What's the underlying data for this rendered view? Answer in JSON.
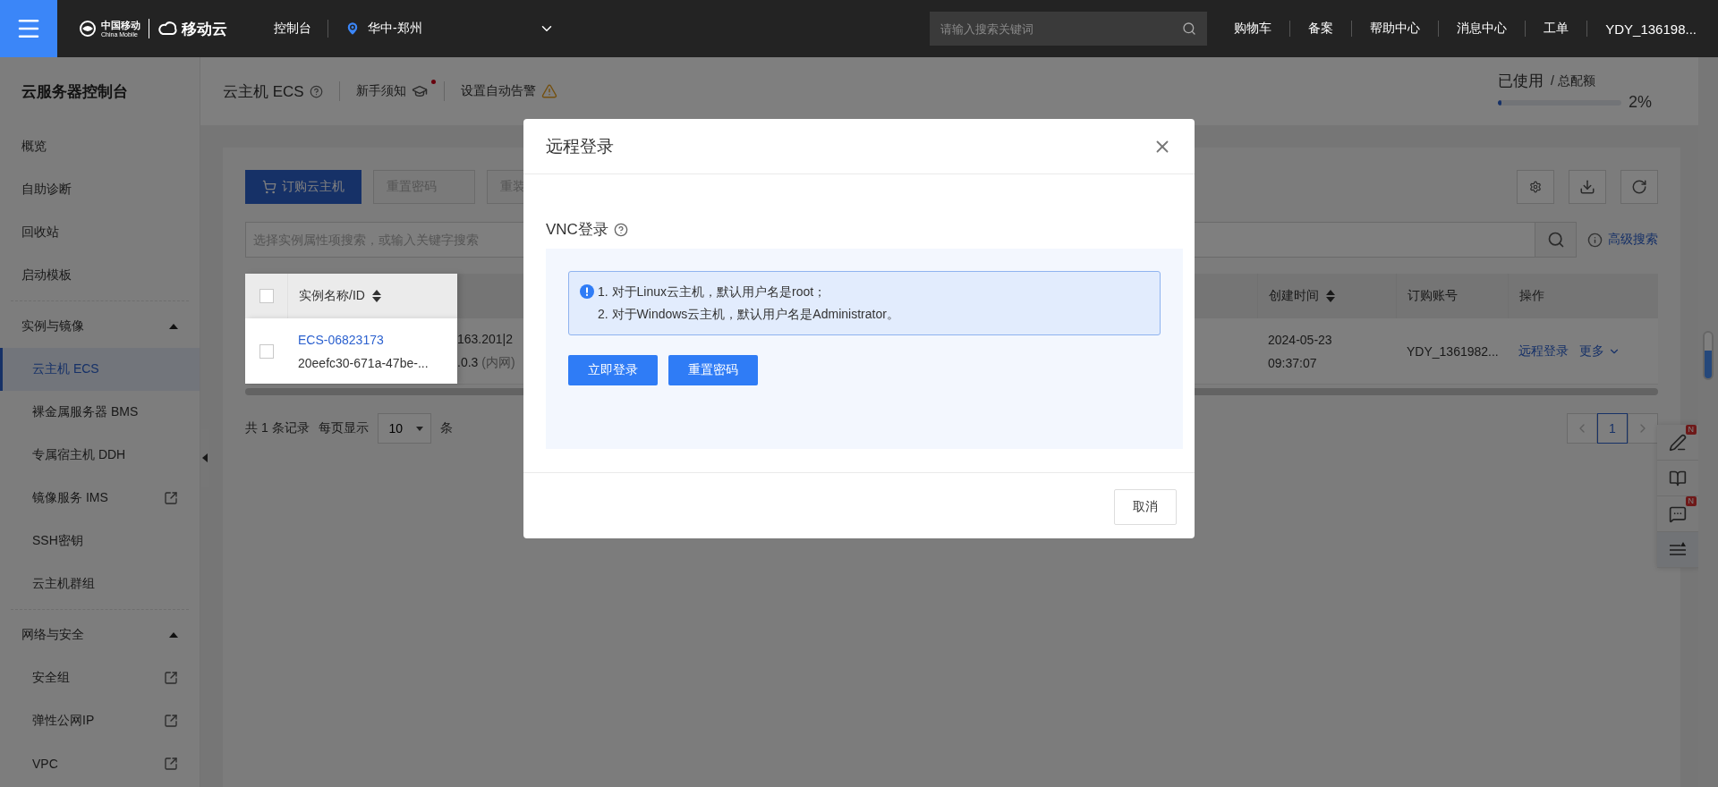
{
  "topbar": {
    "logo": {
      "cn": "中国移动",
      "en": "China Mobile",
      "brand": "移动云"
    },
    "console": "控制台",
    "region": "华中-郑州",
    "search_placeholder": "请输入搜索关键词",
    "links": [
      "购物车",
      "备案",
      "帮助中心",
      "消息中心",
      "工单"
    ],
    "user": "YDY_136198..."
  },
  "sidebar": {
    "title": "云服务器控制台",
    "items": [
      {
        "kind": "item",
        "label": "概览",
        "selected": false
      },
      {
        "kind": "item",
        "label": "自助诊断",
        "selected": false
      },
      {
        "kind": "item",
        "label": "回收站",
        "selected": false
      },
      {
        "kind": "item",
        "label": "启动模板",
        "selected": false
      },
      {
        "kind": "group",
        "label": "实例与镜像",
        "expanded": true,
        "children": [
          {
            "label": "云主机 ECS",
            "selected": true,
            "external": false
          },
          {
            "label": "裸金属服务器 BMS",
            "selected": false,
            "external": false
          },
          {
            "label": "专属宿主机 DDH",
            "selected": false,
            "external": false
          },
          {
            "label": "镜像服务 IMS",
            "selected": false,
            "external": true
          },
          {
            "label": "SSH密钥",
            "selected": false,
            "external": false
          },
          {
            "label": "云主机群组",
            "selected": false,
            "external": false
          }
        ]
      },
      {
        "kind": "group",
        "label": "网络与安全",
        "expanded": true,
        "children": [
          {
            "label": "安全组",
            "selected": false,
            "external": true
          },
          {
            "label": "弹性公网IP",
            "selected": false,
            "external": true
          },
          {
            "label": "VPC",
            "selected": false,
            "external": true
          }
        ]
      }
    ]
  },
  "header": {
    "title": "云主机 ECS",
    "guide": "新手须知",
    "guide_unread": true,
    "alarm": "设置自动告警"
  },
  "quota": {
    "used": "已使用",
    "total": "/ 总配额",
    "level": 0.02,
    "percent": "2%"
  },
  "toolbar": {
    "buttons": [
      {
        "label": "订购云主机",
        "kind": "primary",
        "disabled": false
      },
      {
        "label": "重置密码",
        "kind": "default",
        "disabled": true
      },
      {
        "label": "重装",
        "kind": "default",
        "disabled": true
      }
    ]
  },
  "search": {
    "placeholder": "选择实例属性项搜索，或输入关键字搜索",
    "advanced": "高级搜索"
  },
  "table": {
    "header_checked": false,
    "name_column": "实例名称/ID",
    "right_columns": [
      {
        "label": "创建时间",
        "sortable": true
      },
      {
        "label": "订购账号",
        "sortable": false
      },
      {
        "label": "操作",
        "sortable": false
      }
    ],
    "rows": [
      {
        "checked": false,
        "name": "ECS-06823173",
        "id": "20eefc30-671a-47be-...",
        "ip_line_1": "163.201|2",
        "ip_line_2": ".0.3",
        "ip_note": "(内网)",
        "created_date": "2024-05-23",
        "created_time": "09:37:07",
        "account": "YDY_1361982...",
        "actions": [
          "远程登录",
          "更多"
        ]
      }
    ]
  },
  "pagination": {
    "total": "共 1 条记录",
    "per_page_label": "每页显示",
    "per_page": "10",
    "unit": "条",
    "pages": [
      {
        "label": "1",
        "selected": true
      }
    ]
  },
  "float_tools": [
    {
      "kind": "edit",
      "badge": "N"
    },
    {
      "kind": "book"
    },
    {
      "kind": "chat",
      "badge": "N"
    },
    {
      "kind": "collapse"
    }
  ],
  "modal": {
    "title": "远程登录",
    "section": "VNC登录",
    "notes": [
      "1. 对于Linux云主机，默认用户名是root；",
      "2. 对于Windows云主机，默认用户名是Administrator。"
    ],
    "buttons": [
      "立即登录",
      "重置密码"
    ],
    "cancel": "取消"
  }
}
